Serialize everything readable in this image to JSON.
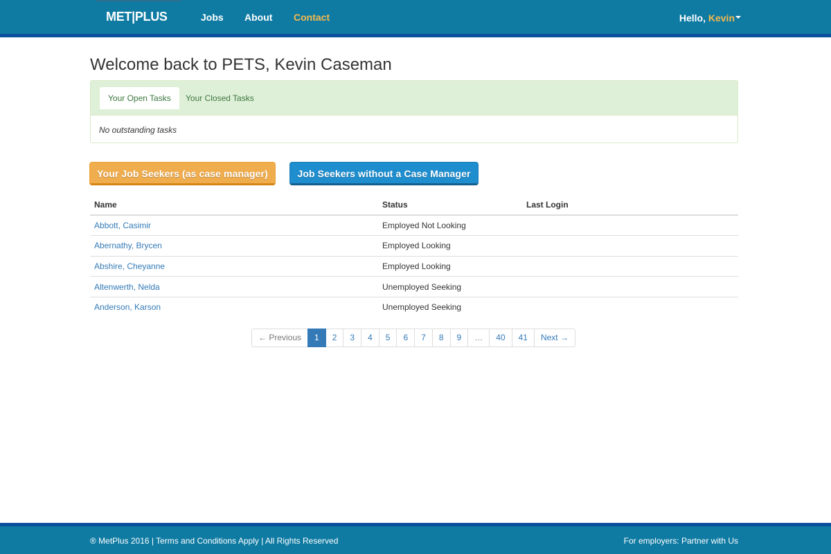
{
  "header": {
    "brand": "MET|PLUS",
    "nav": [
      {
        "label": "Jobs"
      },
      {
        "label": "About"
      },
      {
        "label": "Contact"
      }
    ],
    "greeting": "Hello, ",
    "user_name": "Kevin"
  },
  "main": {
    "title": "Welcome back to PETS, Kevin Caseman",
    "tasks": {
      "tabs": [
        "Your Open Tasks",
        "Your Closed Tasks"
      ],
      "empty_message": "No outstanding tasks"
    },
    "buttons": {
      "my_job_seekers": "Your Job Seekers (as case manager)",
      "without_cm": "Job Seekers without a Case Manager"
    },
    "table": {
      "headers": [
        "Name",
        "Status",
        "Last Login"
      ],
      "rows": [
        {
          "name": "Abbott, Casimir",
          "status": "Employed Not Looking",
          "last_login": ""
        },
        {
          "name": "Abernathy, Brycen",
          "status": "Employed Looking",
          "last_login": ""
        },
        {
          "name": "Abshire, Cheyanne",
          "status": "Employed Looking",
          "last_login": ""
        },
        {
          "name": "Altenwerth, Nelda",
          "status": "Unemployed Seeking",
          "last_login": ""
        },
        {
          "name": "Anderson, Karson",
          "status": "Unemployed Seeking",
          "last_login": ""
        }
      ]
    },
    "pagination": {
      "previous": "← Previous",
      "pages": [
        "1",
        "2",
        "3",
        "4",
        "5",
        "6",
        "7",
        "8",
        "9",
        "…",
        "40",
        "41"
      ],
      "current": "1",
      "next": "Next →"
    }
  },
  "footer": {
    "left": "® MetPlus 2016 | Terms and Conditions Apply | All Rights Reserved",
    "right": "For employers: Partner with Us"
  },
  "colors": {
    "header_bg": "#0f7ba3",
    "header_border": "#0a4f9c",
    "accent": "#f5b94e",
    "link": "#337ab7",
    "warning": "#f0ad4e",
    "primary": "#1f8ecf"
  }
}
